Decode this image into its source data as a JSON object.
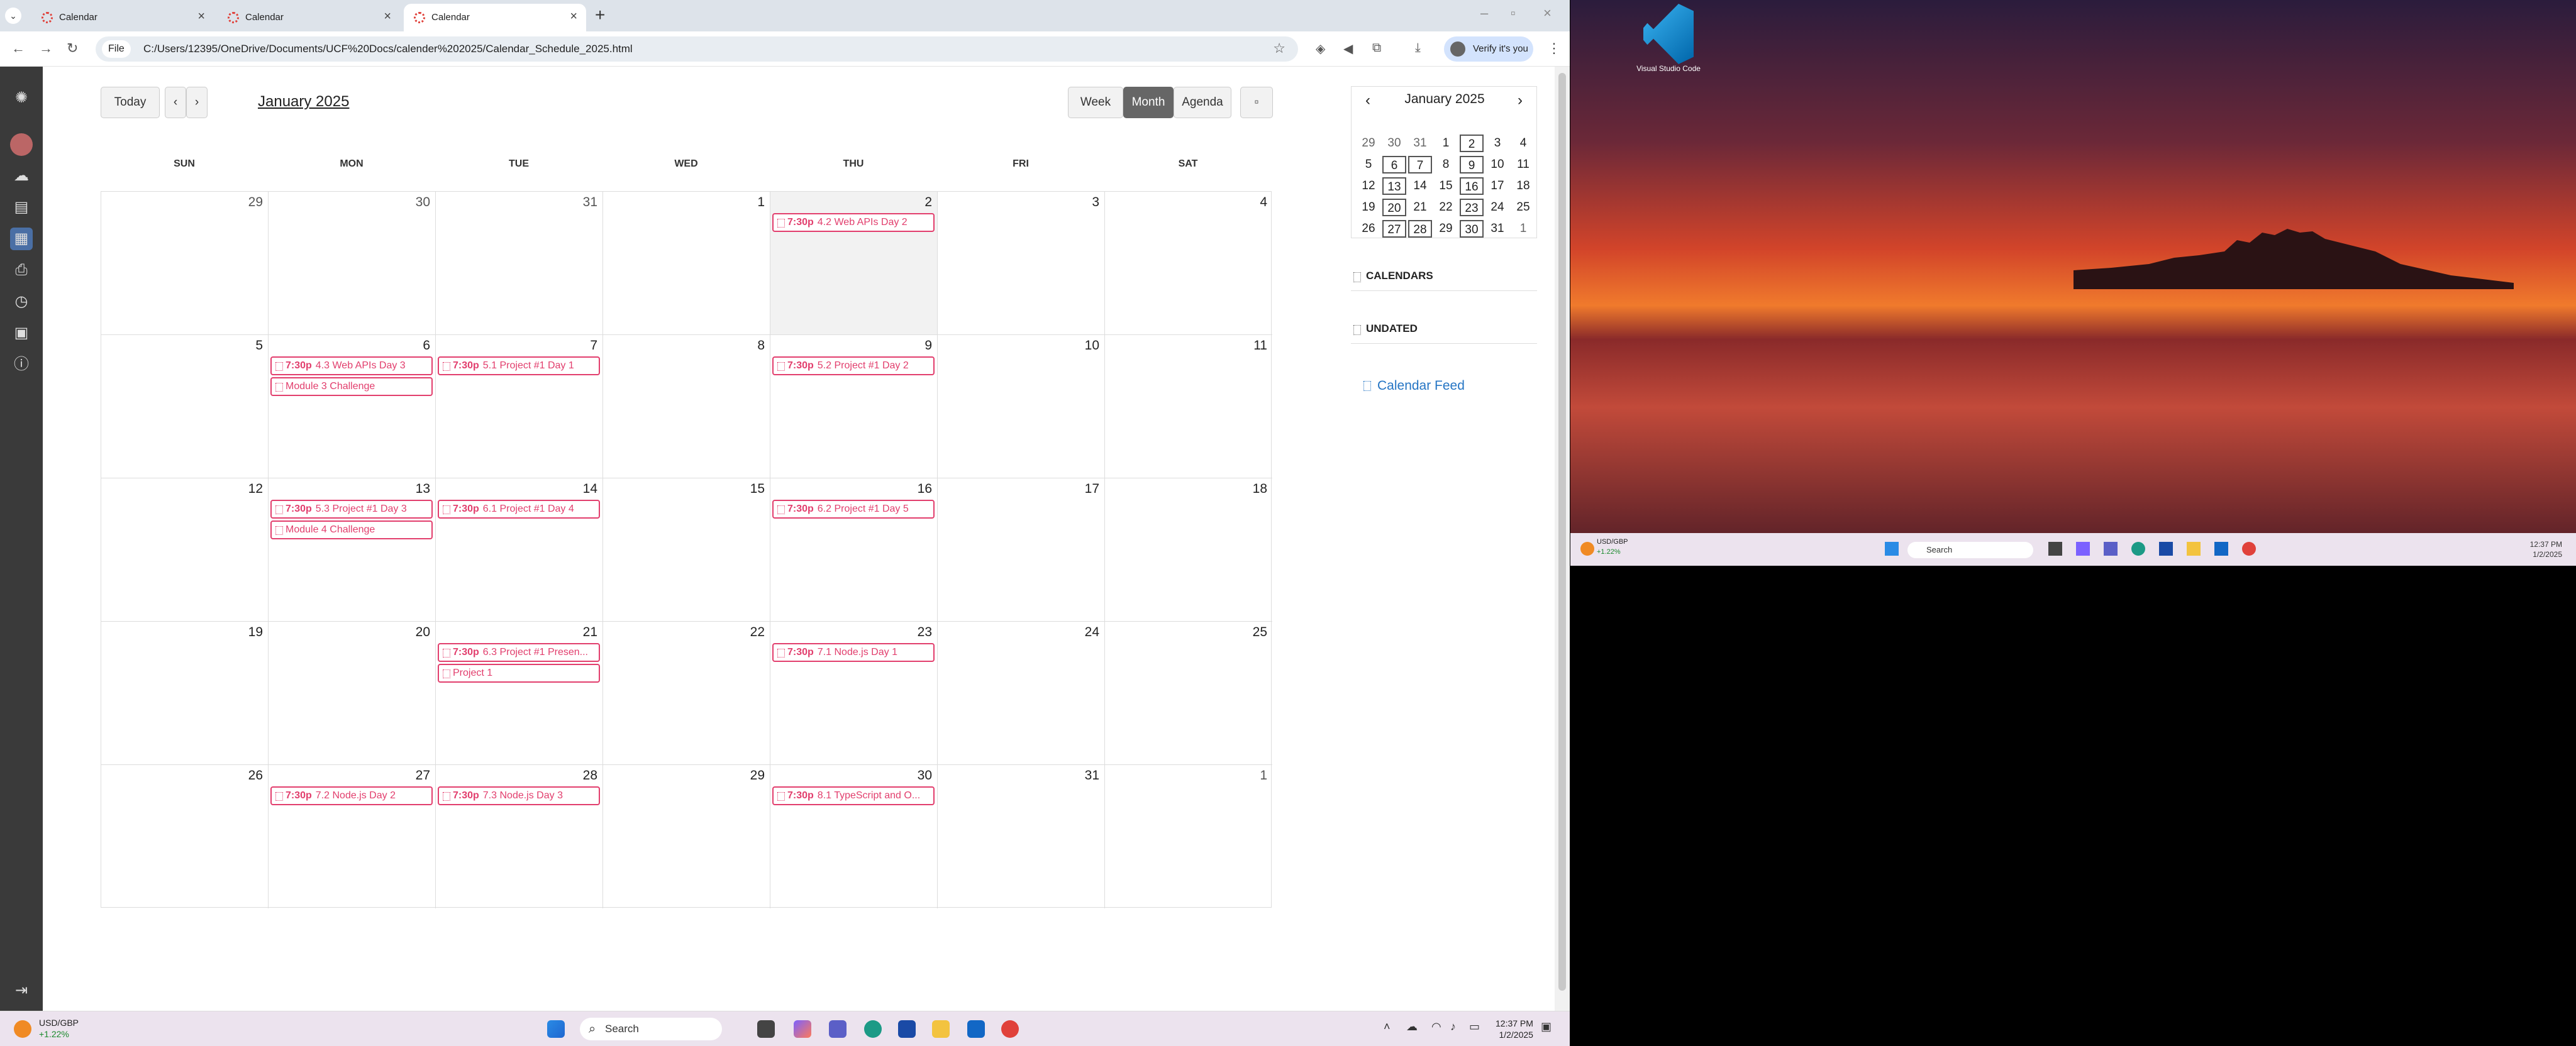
{
  "browser": {
    "tabs": [
      {
        "label": "Calendar"
      },
      {
        "label": "Calendar"
      },
      {
        "label": "Calendar"
      }
    ],
    "new_tab": "+",
    "file_chip": "File",
    "url": "C:/Users/12395/OneDrive/Documents/UCF%20Docs/calender%202025/Calendar_Schedule_2025.html",
    "verify": "Verify it's you"
  },
  "calendar": {
    "today_label": "Today",
    "title": "January 2025",
    "views": {
      "week": "Week",
      "month": "Month",
      "agenda": "Agenda"
    },
    "active_view": "Month",
    "weekdays": [
      "SUN",
      "MON",
      "TUE",
      "WED",
      "THU",
      "FRI",
      "SAT"
    ],
    "day_numbers": [
      "29",
      "30",
      "31",
      "1",
      "2",
      "3",
      "4",
      "5",
      "6",
      "7",
      "8",
      "9",
      "10",
      "11",
      "12",
      "13",
      "14",
      "15",
      "16",
      "17",
      "18",
      "19",
      "20",
      "21",
      "22",
      "23",
      "24",
      "25",
      "26",
      "27",
      "28",
      "29",
      "30",
      "31",
      "1"
    ],
    "events": [
      {
        "time": "7:30p",
        "title": "4.2 Web APIs Day 2"
      },
      {
        "time": "7:30p",
        "title": "4.3 Web APIs Day 3"
      },
      {
        "time": "",
        "title": "Module 3 Challenge"
      },
      {
        "time": "7:30p",
        "title": "5.1 Project #1 Day 1"
      },
      {
        "time": "7:30p",
        "title": "5.2 Project #1 Day 2"
      },
      {
        "time": "7:30p",
        "title": "5.3 Project #1 Day 3"
      },
      {
        "time": "",
        "title": "Module 4 Challenge"
      },
      {
        "time": "7:30p",
        "title": "6.1 Project #1 Day 4"
      },
      {
        "time": "7:30p",
        "title": "6.2 Project #1 Day 5"
      },
      {
        "time": "7:30p",
        "title": "6.3 Project #1 Presen..."
      },
      {
        "time": "",
        "title": "Project 1"
      },
      {
        "time": "7:30p",
        "title": "7.1 Node.js Day 1"
      },
      {
        "time": "7:30p",
        "title": "7.2 Node.js Day 2"
      },
      {
        "time": "7:30p",
        "title": "7.3 Node.js Day 3"
      },
      {
        "time": "7:30p",
        "title": "8.1 TypeScript and O..."
      }
    ],
    "accent_color": "#e23e6d"
  },
  "mini_calendar": {
    "title": "January 2025",
    "days": [
      "29",
      "30",
      "31",
      "1",
      "2",
      "3",
      "4",
      "5",
      "6",
      "7",
      "8",
      "9",
      "10",
      "11",
      "12",
      "13",
      "14",
      "15",
      "16",
      "17",
      "18",
      "19",
      "20",
      "21",
      "22",
      "23",
      "24",
      "25",
      "26",
      "27",
      "28",
      "29",
      "30",
      "31",
      "1"
    ]
  },
  "sidebar": {
    "calendars": "CALENDARS",
    "undated": "UNDATED",
    "feed": "Calendar Feed"
  },
  "taskbar": {
    "ticker_name": "USD/GBP",
    "ticker_change": "+1.22%",
    "search": "Search",
    "time": "12:37 PM",
    "date": "1/2/2025"
  },
  "desktop": {
    "vscode_label": "Visual Studio Code"
  },
  "icons": [
    "search-icon",
    "star-icon",
    "download-icon",
    "calendar-icon",
    "clock-icon",
    "info-icon",
    "windows-start-icon"
  ]
}
